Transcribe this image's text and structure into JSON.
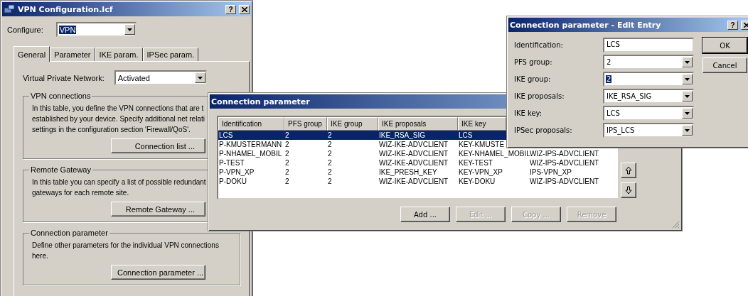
{
  "main_window": {
    "title": "VPN Configuration.lcf",
    "help": "?",
    "configure": {
      "label": "Configure:",
      "value": "VPN",
      "highlighted": true
    },
    "tabs": [
      {
        "label": "General",
        "selected": true
      },
      {
        "label": "Parameter",
        "selected": false
      },
      {
        "label": "IKE param.",
        "selected": false
      },
      {
        "label": "IPSec param.",
        "selected": false
      }
    ],
    "vpn": {
      "label": "Virtual Private Network:",
      "value": "Activated",
      "highlighted": false
    },
    "groups": [
      {
        "title": "VPN connections",
        "text_lines": [
          "In this table, you define the VPN connections that are t",
          "established by your device. Specify additional net relati",
          "settings in the configuration section 'Firewall/QoS'."
        ],
        "button": "Connection list ..."
      },
      {
        "title": "Remote Gateway",
        "text_lines": [
          "In this table you can specify a list of possible redundant",
          "gateways for each remote site."
        ],
        "button": "Remote Gateway ..."
      },
      {
        "title": "Connection parameter",
        "text_lines": [
          "Define other parameters for the individual VPN connections",
          "here."
        ],
        "button": "Connection parameter ..."
      }
    ]
  },
  "connection_dialog": {
    "title": "Connection parameter",
    "table": {
      "columns": [
        "Identification",
        "PFS group",
        "IKE group",
        "IKE proposals",
        "IKE key"
      ],
      "rows": [
        {
          "selected": true,
          "cells": [
            "LCS",
            "2",
            "2",
            "IKE_RSA_SIG",
            "LCS"
          ]
        },
        {
          "selected": false,
          "cells": [
            "P-KMUSTERMANN",
            "2",
            "2",
            "WIZ-IKE-ADVCLIENT",
            "KEY-KMUSTE"
          ]
        },
        {
          "selected": false,
          "cells": [
            "P-NHAMEL_MOBIL",
            "2",
            "2",
            "WIZ-IKE-ADVCLIENT",
            "KEY-NHAMEL_MOBIL",
            "WIZ-IPS-ADVCLIENT"
          ]
        },
        {
          "selected": false,
          "cells": [
            "P-TEST",
            "2",
            "2",
            "WIZ-IKE-ADVCLIENT",
            "KEY-TEST",
            "WIZ-IPS-ADVCLIENT"
          ]
        },
        {
          "selected": false,
          "cells": [
            "P-VPN_XP",
            "2",
            "2",
            "IKE_PRESH_KEY",
            "KEY-VPN_XP",
            "IPS-VPN_XP"
          ]
        },
        {
          "selected": false,
          "cells": [
            "P-DOKU",
            "2",
            "2",
            "WIZ-IKE-ADVCLIENT",
            "KEY-DOKU",
            "WIZ-IPS-ADVCLIENT"
          ]
        }
      ]
    },
    "buttons": [
      {
        "label": "Add ...",
        "disabled": false
      },
      {
        "label": "Edit ...",
        "disabled": true
      },
      {
        "label": "Copy ...",
        "disabled": true
      },
      {
        "label": "Remove",
        "disabled": true
      }
    ]
  },
  "edit_dialog": {
    "title": "Connection parameter - Edit Entry",
    "help": "?",
    "fields": [
      {
        "kind": "text",
        "label": "Identification:",
        "value": "LCS",
        "highlighted": false
      },
      {
        "kind": "combo",
        "label": "PFS group:",
        "value": "2",
        "highlighted": false
      },
      {
        "kind": "combo",
        "label": "IKE group:",
        "value": "2",
        "highlighted": true
      },
      {
        "kind": "combo",
        "label": "IKE proposals:",
        "value": "IKE_RSA_SIG",
        "highlighted": false
      },
      {
        "kind": "combo",
        "label": "IKE key:",
        "value": "LCS",
        "highlighted": false
      },
      {
        "kind": "combo",
        "label": "IPSec proposals:",
        "value": "IPS_LCS",
        "highlighted": false
      }
    ],
    "buttons": [
      "OK",
      "Cancel"
    ]
  }
}
